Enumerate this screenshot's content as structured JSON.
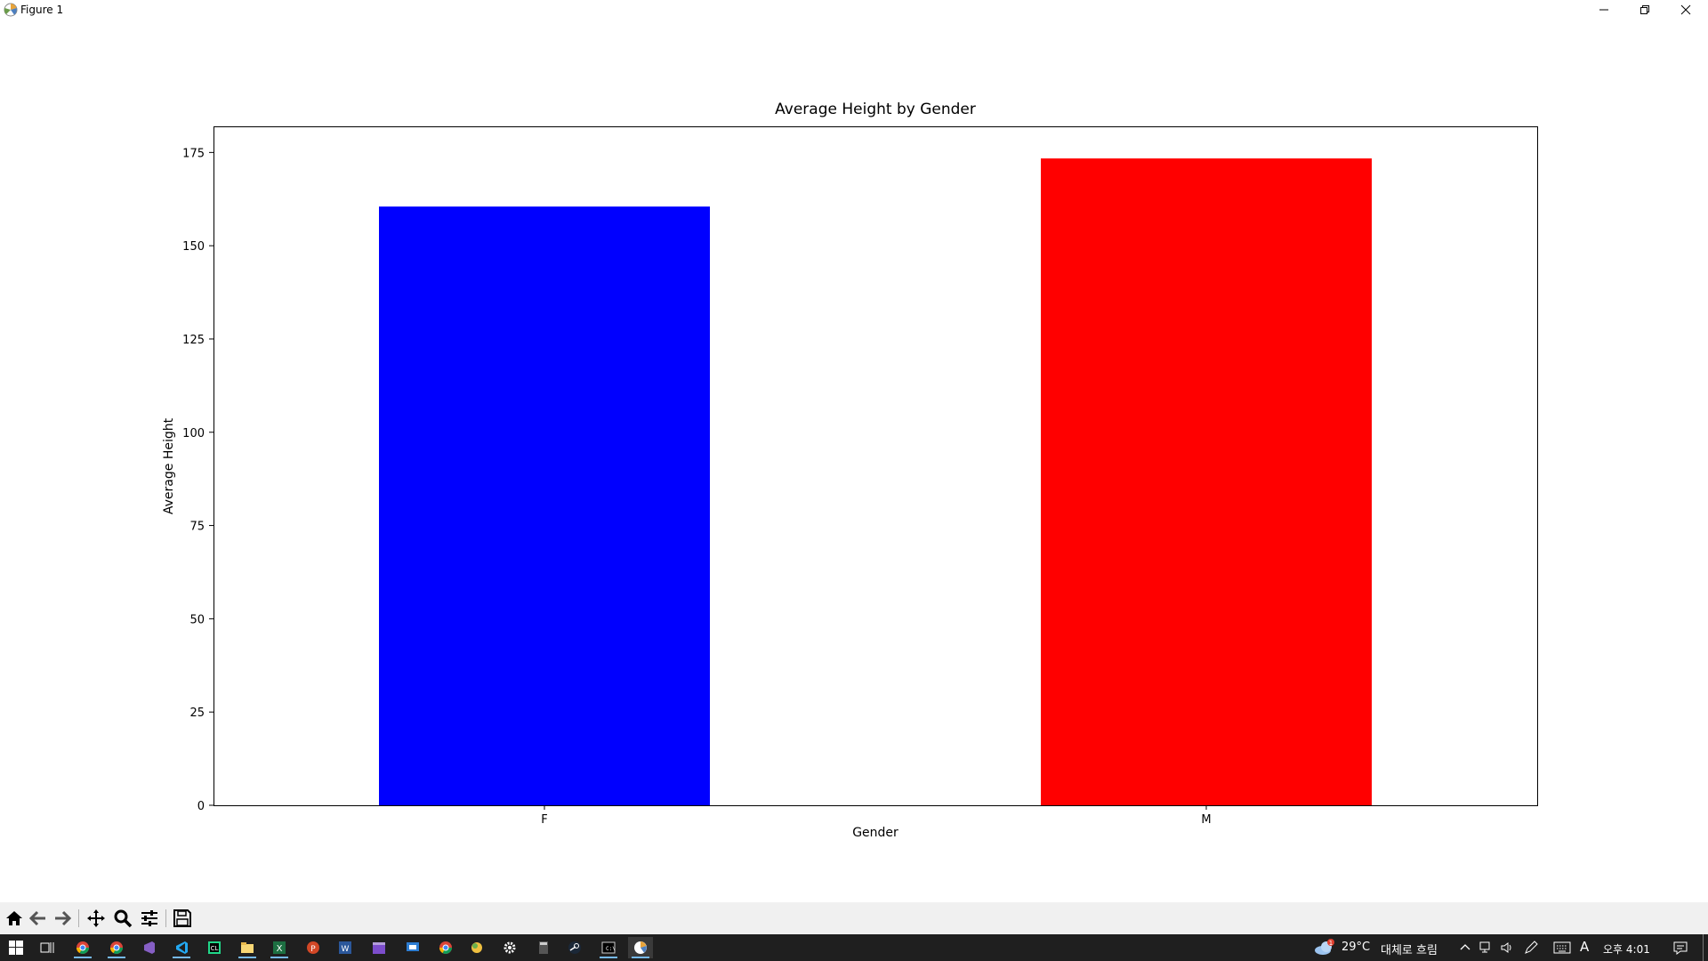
{
  "window": {
    "title": "Figure 1",
    "controls": {
      "minimize": "minimize-icon",
      "restore": "restore-icon",
      "close": "close-icon"
    }
  },
  "toolbar": {
    "buttons": [
      "home-icon",
      "back-icon",
      "forward-icon",
      "pan-icon",
      "zoom-icon",
      "configure-subplots-icon",
      "save-icon"
    ]
  },
  "chart_data": {
    "type": "bar",
    "title": "Average Height by Gender",
    "xlabel": "Gender",
    "ylabel": "Average Height",
    "categories": [
      "F",
      "M"
    ],
    "values": [
      160.5,
      173.4
    ],
    "colors": [
      "#0000ff",
      "#ff0000"
    ],
    "ylim": [
      0,
      182
    ],
    "yticks": [
      0,
      25,
      50,
      75,
      100,
      125,
      150,
      175
    ],
    "grid": false,
    "legend": false
  },
  "taskbar": {
    "apps": [
      "chrome-icon",
      "chrome-icon",
      "visual-studio-icon",
      "vscode-icon",
      "clion-icon",
      "file-explorer-icon",
      "excel-icon",
      "powerpoint-icon",
      "word-icon",
      "clapperboard-icon",
      "remote-desktop-icon",
      "chrome-icon",
      "color-dot-icon",
      "settings-icon",
      "calculator-icon",
      "steam-icon",
      "terminal-icon",
      "python-figure-icon"
    ],
    "weather": {
      "temp": "29°C",
      "condition": "대체로 흐림",
      "badge": "1"
    },
    "ime": "A",
    "clock": "오후 4:01"
  },
  "colors": {
    "toolbar_bg": "#f0f0f0",
    "taskbar_bg": "#1f1f1f",
    "accent": "#76b9ed"
  }
}
